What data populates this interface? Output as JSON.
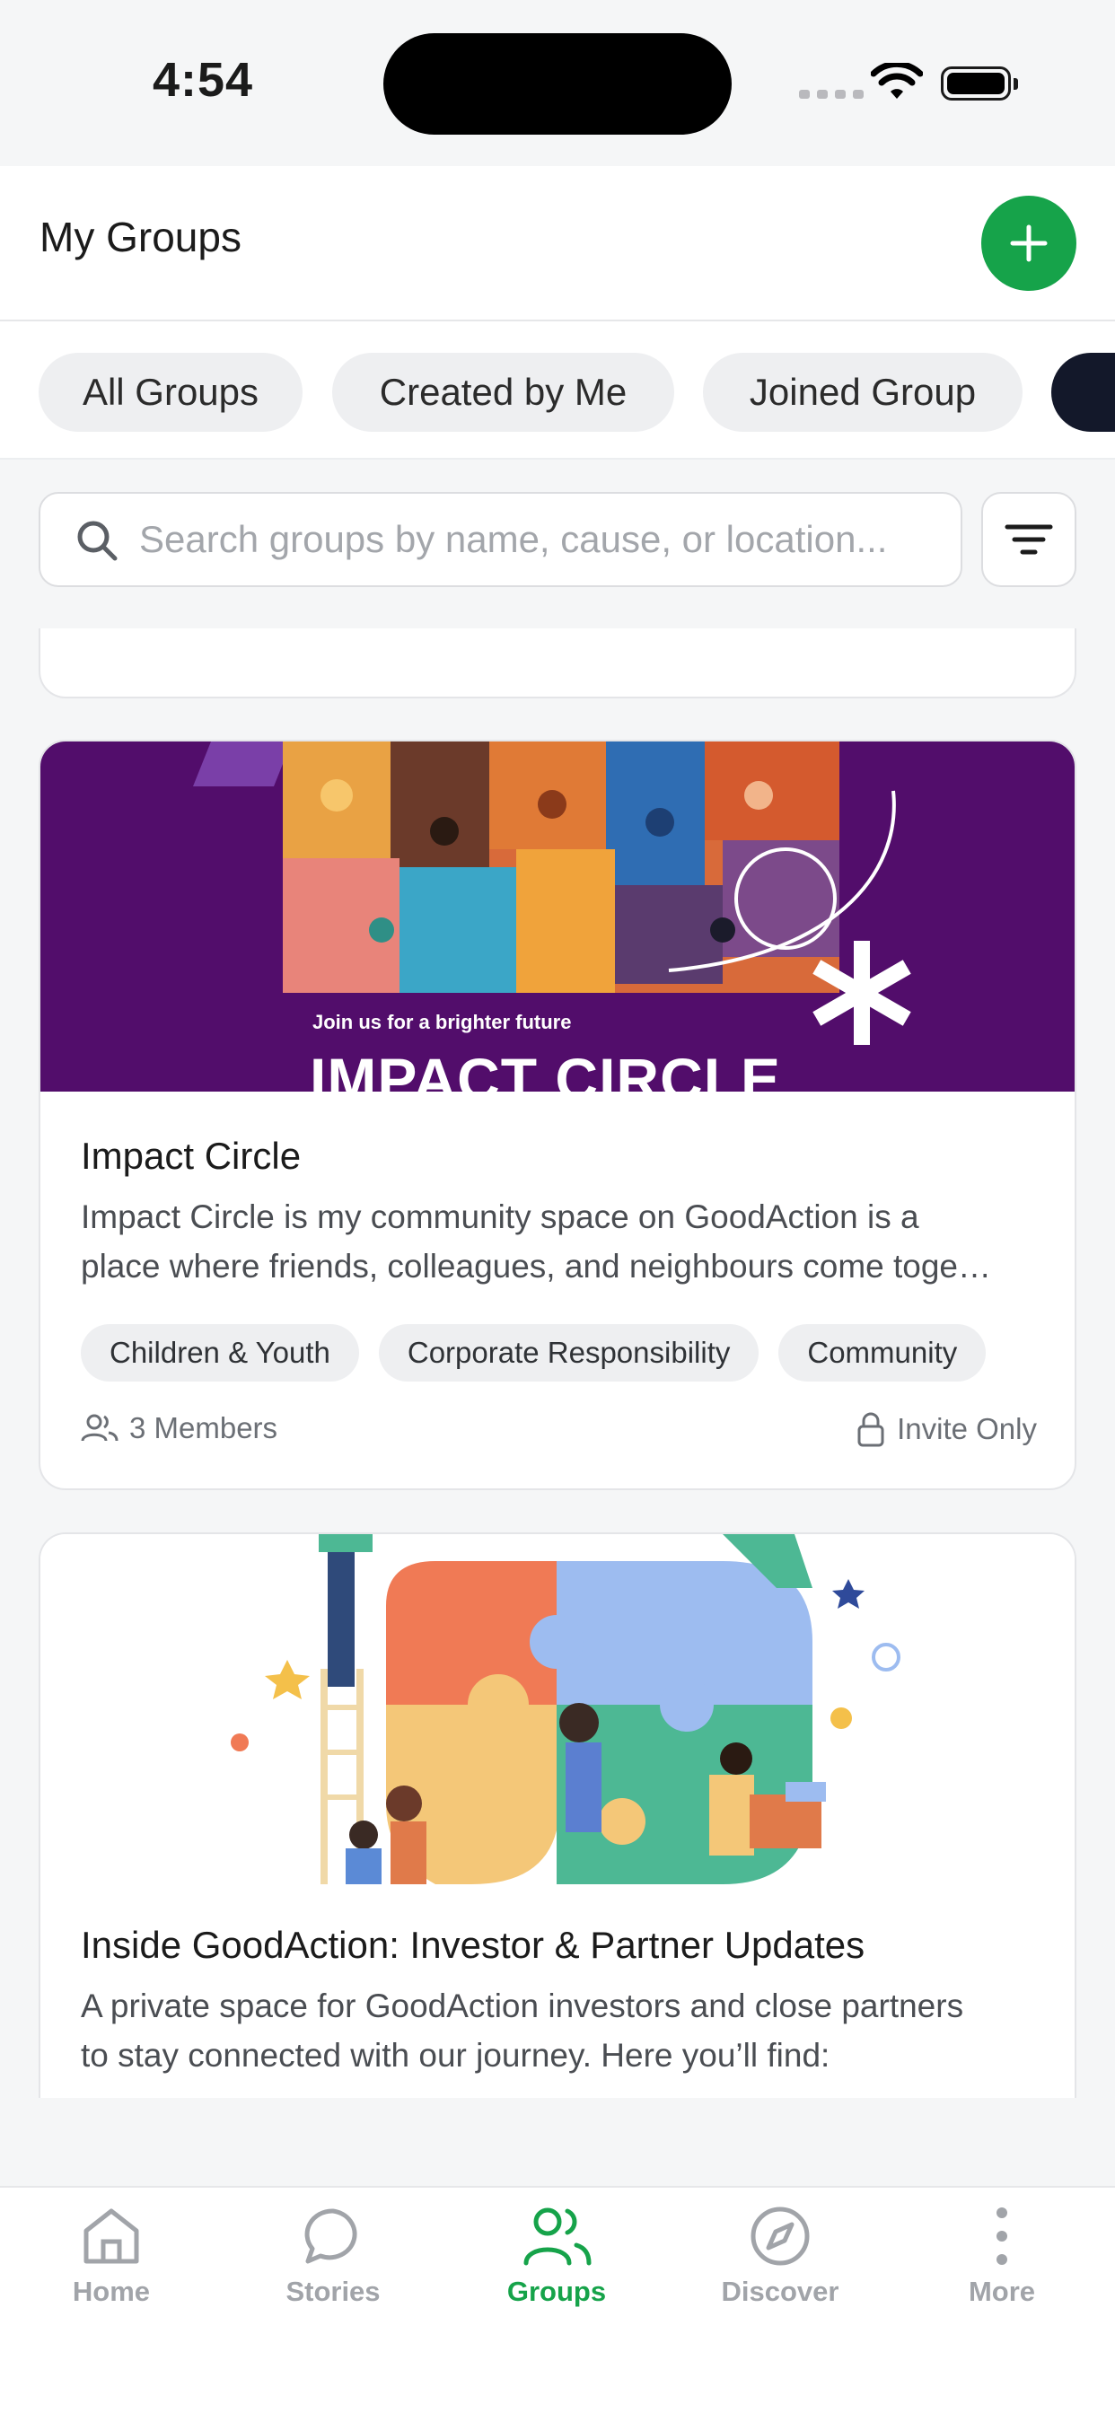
{
  "status_bar": {
    "time": "4:54"
  },
  "header": {
    "title": "My Groups",
    "add_icon": "plus-icon"
  },
  "tabs": [
    {
      "label": "All Groups"
    },
    {
      "label": "Created by Me"
    },
    {
      "label": "Joined Group"
    }
  ],
  "search": {
    "placeholder": "Search groups by name, cause, or location..."
  },
  "groups": [
    {
      "banner": {
        "tagline": "Join us for a brighter future",
        "headline": "IMPACT CIRCLE"
      },
      "title": "Impact Circle",
      "description_line1": "Impact Circle is my community space on GoodAction is a",
      "description_line2": "place where friends, colleagues, and neighbours come toge…",
      "tags": [
        "Children & Youth",
        "Corporate Responsibility",
        "Community"
      ],
      "members": "3 Members",
      "privacy": "Invite Only"
    },
    {
      "title": "Inside GoodAction: Investor & Partner Updates",
      "description_line1": "A private space for GoodAction investors and close partners",
      "description_line2": "to stay connected with our journey. Here you’ll find:"
    }
  ],
  "bottom_nav": [
    {
      "label": "Home",
      "icon": "home-icon"
    },
    {
      "label": "Stories",
      "icon": "chat-bubble-icon"
    },
    {
      "label": "Groups",
      "icon": "users-icon",
      "active": true
    },
    {
      "label": "Discover",
      "icon": "compass-icon"
    },
    {
      "label": "More",
      "icon": "more-vertical-icon"
    }
  ],
  "colors": {
    "accent": "#16a34a",
    "banner_purple": "#520d6b",
    "active_tab_partial": "#13182a"
  }
}
